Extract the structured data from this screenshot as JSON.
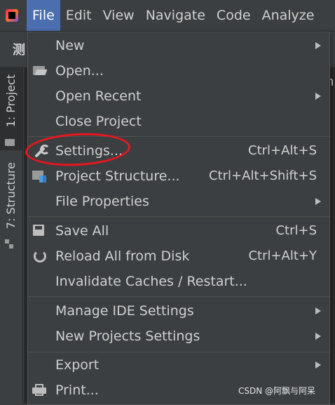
{
  "menubar": {
    "items": [
      "File",
      "Edit",
      "View",
      "Navigate",
      "Code",
      "Analyze"
    ],
    "active": "File"
  },
  "toolbar": {
    "project_char": "测"
  },
  "left_strip": {
    "project_tab": "1: Project",
    "structure_tab": "7: Structure"
  },
  "file_menu": {
    "items": [
      {
        "label": "New",
        "shortcut": "",
        "icon": "",
        "submenu": true
      },
      {
        "label": "Open...",
        "shortcut": "",
        "icon": "folder-open-icon",
        "submenu": false
      },
      {
        "label": "Open Recent",
        "shortcut": "",
        "icon": "",
        "submenu": true
      },
      {
        "label": "Close Project",
        "shortcut": "",
        "icon": "",
        "submenu": false
      },
      {
        "label": "Settings...",
        "shortcut": "Ctrl+Alt+S",
        "icon": "wrench-icon",
        "submenu": false
      },
      {
        "label": "Project Structure...",
        "shortcut": "Ctrl+Alt+Shift+S",
        "icon": "project-structure-icon",
        "submenu": false
      },
      {
        "label": "File Properties",
        "shortcut": "",
        "icon": "",
        "submenu": true
      },
      {
        "label": "Save All",
        "shortcut": "Ctrl+S",
        "icon": "save-icon",
        "submenu": false
      },
      {
        "label": "Reload All from Disk",
        "shortcut": "Ctrl+Alt+Y",
        "icon": "reload-icon",
        "submenu": false
      },
      {
        "label": "Invalidate Caches / Restart...",
        "shortcut": "",
        "icon": "",
        "submenu": false
      },
      {
        "label": "Manage IDE Settings",
        "shortcut": "",
        "icon": "",
        "submenu": true
      },
      {
        "label": "New Projects Settings",
        "shortcut": "",
        "icon": "",
        "submenu": true
      },
      {
        "label": "Export",
        "shortcut": "",
        "icon": "",
        "submenu": true
      },
      {
        "label": "Print...",
        "shortcut": "",
        "icon": "print-icon",
        "submenu": false
      }
    ]
  },
  "watermark": "CSDN @阿飘与阿呆",
  "colors": {
    "menubar_active": "#4b6eaf",
    "annotation_circle": "#e8161f",
    "menu_bg": "#3c3f41"
  }
}
